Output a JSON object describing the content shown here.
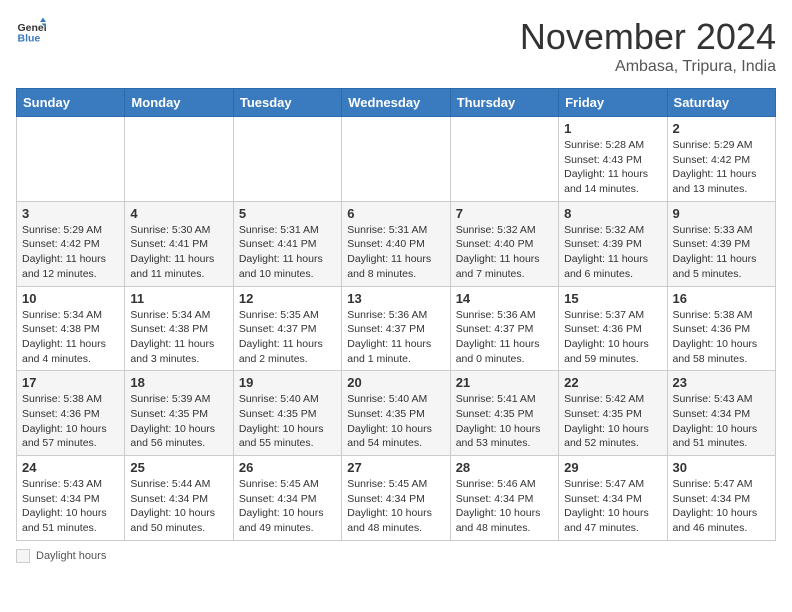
{
  "header": {
    "logo_general": "General",
    "logo_blue": "Blue",
    "month_title": "November 2024",
    "location": "Ambasa, Tripura, India"
  },
  "days_of_week": [
    "Sunday",
    "Monday",
    "Tuesday",
    "Wednesday",
    "Thursday",
    "Friday",
    "Saturday"
  ],
  "footer": {
    "daylight_label": "Daylight hours"
  },
  "weeks": [
    {
      "days": [
        {
          "date": "",
          "info": ""
        },
        {
          "date": "",
          "info": ""
        },
        {
          "date": "",
          "info": ""
        },
        {
          "date": "",
          "info": ""
        },
        {
          "date": "",
          "info": ""
        },
        {
          "date": "1",
          "info": "Sunrise: 5:28 AM\nSunset: 4:43 PM\nDaylight: 11 hours and 14 minutes."
        },
        {
          "date": "2",
          "info": "Sunrise: 5:29 AM\nSunset: 4:42 PM\nDaylight: 11 hours and 13 minutes."
        }
      ]
    },
    {
      "days": [
        {
          "date": "3",
          "info": "Sunrise: 5:29 AM\nSunset: 4:42 PM\nDaylight: 11 hours and 12 minutes."
        },
        {
          "date": "4",
          "info": "Sunrise: 5:30 AM\nSunset: 4:41 PM\nDaylight: 11 hours and 11 minutes."
        },
        {
          "date": "5",
          "info": "Sunrise: 5:31 AM\nSunset: 4:41 PM\nDaylight: 11 hours and 10 minutes."
        },
        {
          "date": "6",
          "info": "Sunrise: 5:31 AM\nSunset: 4:40 PM\nDaylight: 11 hours and 8 minutes."
        },
        {
          "date": "7",
          "info": "Sunrise: 5:32 AM\nSunset: 4:40 PM\nDaylight: 11 hours and 7 minutes."
        },
        {
          "date": "8",
          "info": "Sunrise: 5:32 AM\nSunset: 4:39 PM\nDaylight: 11 hours and 6 minutes."
        },
        {
          "date": "9",
          "info": "Sunrise: 5:33 AM\nSunset: 4:39 PM\nDaylight: 11 hours and 5 minutes."
        }
      ]
    },
    {
      "days": [
        {
          "date": "10",
          "info": "Sunrise: 5:34 AM\nSunset: 4:38 PM\nDaylight: 11 hours and 4 minutes."
        },
        {
          "date": "11",
          "info": "Sunrise: 5:34 AM\nSunset: 4:38 PM\nDaylight: 11 hours and 3 minutes."
        },
        {
          "date": "12",
          "info": "Sunrise: 5:35 AM\nSunset: 4:37 PM\nDaylight: 11 hours and 2 minutes."
        },
        {
          "date": "13",
          "info": "Sunrise: 5:36 AM\nSunset: 4:37 PM\nDaylight: 11 hours and 1 minute."
        },
        {
          "date": "14",
          "info": "Sunrise: 5:36 AM\nSunset: 4:37 PM\nDaylight: 11 hours and 0 minutes."
        },
        {
          "date": "15",
          "info": "Sunrise: 5:37 AM\nSunset: 4:36 PM\nDaylight: 10 hours and 59 minutes."
        },
        {
          "date": "16",
          "info": "Sunrise: 5:38 AM\nSunset: 4:36 PM\nDaylight: 10 hours and 58 minutes."
        }
      ]
    },
    {
      "days": [
        {
          "date": "17",
          "info": "Sunrise: 5:38 AM\nSunset: 4:36 PM\nDaylight: 10 hours and 57 minutes."
        },
        {
          "date": "18",
          "info": "Sunrise: 5:39 AM\nSunset: 4:35 PM\nDaylight: 10 hours and 56 minutes."
        },
        {
          "date": "19",
          "info": "Sunrise: 5:40 AM\nSunset: 4:35 PM\nDaylight: 10 hours and 55 minutes."
        },
        {
          "date": "20",
          "info": "Sunrise: 5:40 AM\nSunset: 4:35 PM\nDaylight: 10 hours and 54 minutes."
        },
        {
          "date": "21",
          "info": "Sunrise: 5:41 AM\nSunset: 4:35 PM\nDaylight: 10 hours and 53 minutes."
        },
        {
          "date": "22",
          "info": "Sunrise: 5:42 AM\nSunset: 4:35 PM\nDaylight: 10 hours and 52 minutes."
        },
        {
          "date": "23",
          "info": "Sunrise: 5:43 AM\nSunset: 4:34 PM\nDaylight: 10 hours and 51 minutes."
        }
      ]
    },
    {
      "days": [
        {
          "date": "24",
          "info": "Sunrise: 5:43 AM\nSunset: 4:34 PM\nDaylight: 10 hours and 51 minutes."
        },
        {
          "date": "25",
          "info": "Sunrise: 5:44 AM\nSunset: 4:34 PM\nDaylight: 10 hours and 50 minutes."
        },
        {
          "date": "26",
          "info": "Sunrise: 5:45 AM\nSunset: 4:34 PM\nDaylight: 10 hours and 49 minutes."
        },
        {
          "date": "27",
          "info": "Sunrise: 5:45 AM\nSunset: 4:34 PM\nDaylight: 10 hours and 48 minutes."
        },
        {
          "date": "28",
          "info": "Sunrise: 5:46 AM\nSunset: 4:34 PM\nDaylight: 10 hours and 48 minutes."
        },
        {
          "date": "29",
          "info": "Sunrise: 5:47 AM\nSunset: 4:34 PM\nDaylight: 10 hours and 47 minutes."
        },
        {
          "date": "30",
          "info": "Sunrise: 5:47 AM\nSunset: 4:34 PM\nDaylight: 10 hours and 46 minutes."
        }
      ]
    }
  ]
}
